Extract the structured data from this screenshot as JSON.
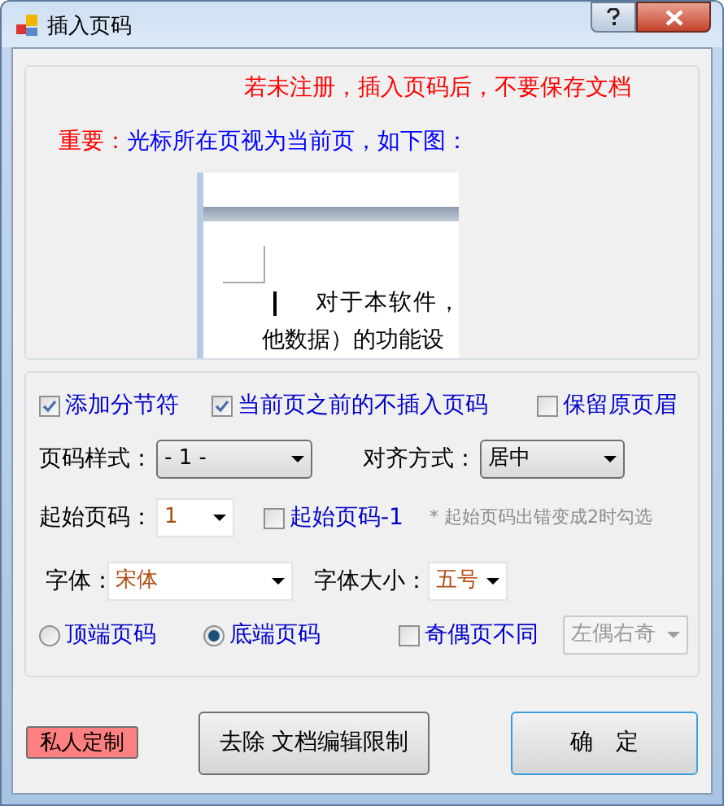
{
  "window": {
    "title": "插入页码"
  },
  "notice": "若未注册，插入页码后，不要保存文档",
  "important": {
    "label": "重要：",
    "text": "光标所在页视为当前页，如下图："
  },
  "preview": {
    "line_1": "对于本软件，",
    "line_2": "他数据）的功能设"
  },
  "options": [
    {
      "label": "添加分节符",
      "checked": true
    },
    {
      "label": "当前页之前的不插入页码",
      "checked": true
    },
    {
      "label": "保留原页眉",
      "checked": false
    }
  ],
  "page_style": {
    "label": "页码样式：",
    "value": "- 1 -"
  },
  "align": {
    "label": "对齐方式：",
    "value": "居中"
  },
  "start_page": {
    "label": "起始页码：",
    "value": "1"
  },
  "start_minus": {
    "label": "起始页码-1",
    "checked": false
  },
  "hint": "* 起始页码出错变成2时勾选",
  "font": {
    "label": "字体：",
    "value": "宋体"
  },
  "font_size": {
    "label": "字体大小：",
    "value": "五号"
  },
  "position": [
    {
      "label": "顶端页码",
      "selected": false
    },
    {
      "label": "底端页码",
      "selected": true
    }
  ],
  "odd_even": {
    "label": "奇偶页不同",
    "checked": false
  },
  "odd_even_mode": {
    "value": "左偶右奇",
    "disabled": true
  },
  "buttons": {
    "custom": "私人定制",
    "remove": "去除 文档编辑限制",
    "ok": "确　定"
  }
}
